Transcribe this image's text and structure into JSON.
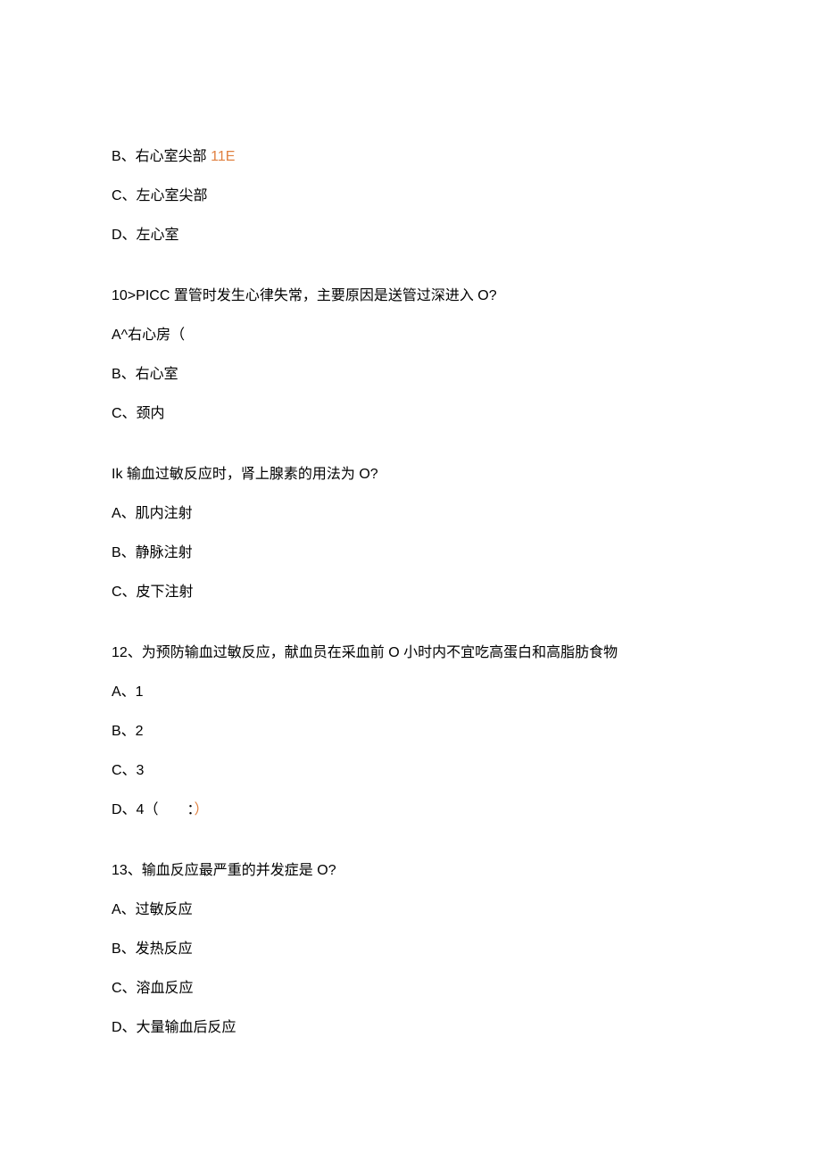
{
  "lines": {
    "q9b": "B、右心室尖部 ",
    "q9b_suffix": "11E",
    "q9c": "C、左心室尖部",
    "q9d": "D、左心室",
    "q10": "10>PICC 置管时发生心律失常，主要原因是送管过深进入 O?",
    "q10a": "A^右心房（",
    "q10b": "B、右心室",
    "q10c": "C、颈内",
    "q11": "Ik 输血过敏反应时，肾上腺素的用法为 O?",
    "q11a": "A、肌内注射",
    "q11b": "B、静脉注射",
    "q11c": "C、皮下注射",
    "q12": "12、为预防输血过敏反应，献血员在采血前 O 小时内不宜吃高蛋白和高脂肪食物",
    "q12a": "A、1",
    "q12b": "B、2",
    "q12c": "C、3",
    "q12d": "D、4（  ：",
    "q12d_suffix": "）",
    "q13": "13、输血反应最严重的并发症是 O?",
    "q13a": "A、过敏反应",
    "q13b": "B、发热反应",
    "q13c": "C、溶血反应",
    "q13d": "D、大量输血后反应"
  }
}
